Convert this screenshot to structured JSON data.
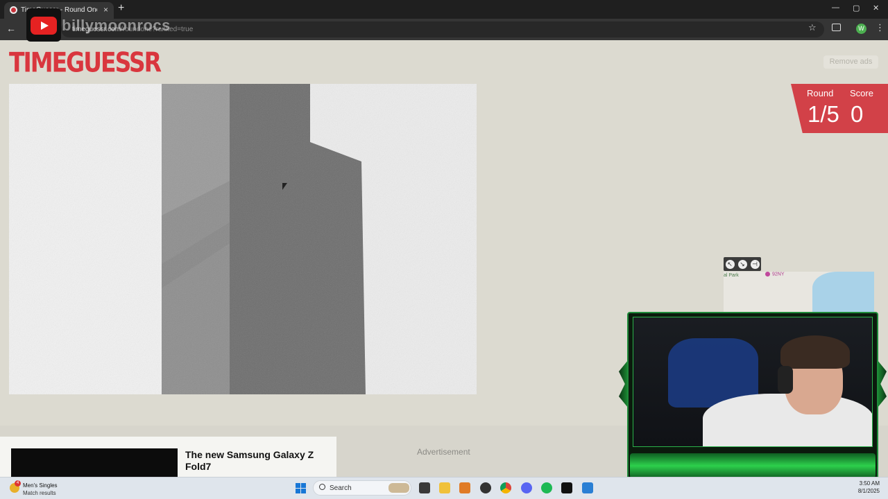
{
  "browser": {
    "tab_title": "TimeGuessr - Round One",
    "tab_close": "×",
    "new_tab": "+",
    "url_host": "timeguessr.com",
    "url_rest": "/roundone?ranked=true",
    "back": "←",
    "star": "☆",
    "menu": "⋮",
    "profile_initial": "W",
    "minimize": "—",
    "maximize": "▢",
    "close": "✕"
  },
  "stream_overlay": {
    "channel_name": "billymoonrocs"
  },
  "page": {
    "logo": "TIMEGUESSR",
    "remove_ads": "Remove ads",
    "score": {
      "round_label": "Round",
      "round_value": "1/5",
      "score_label": "Score",
      "score_value": "0"
    },
    "map": {
      "park_label": "al Park",
      "poi_label": "92NY"
    },
    "ad": {
      "headline": "The new Samsung Galaxy Z Fold7",
      "label": "Advertisement"
    }
  },
  "taskbar": {
    "weather_title": "Men's Singles",
    "weather_subtitle": "Match results",
    "badge": "4",
    "search_placeholder": "Search",
    "time": "3:50 AM",
    "date": "8/1/2025"
  },
  "colors": {
    "accent": "#d9363e",
    "page_bg": "#dcdad0"
  }
}
